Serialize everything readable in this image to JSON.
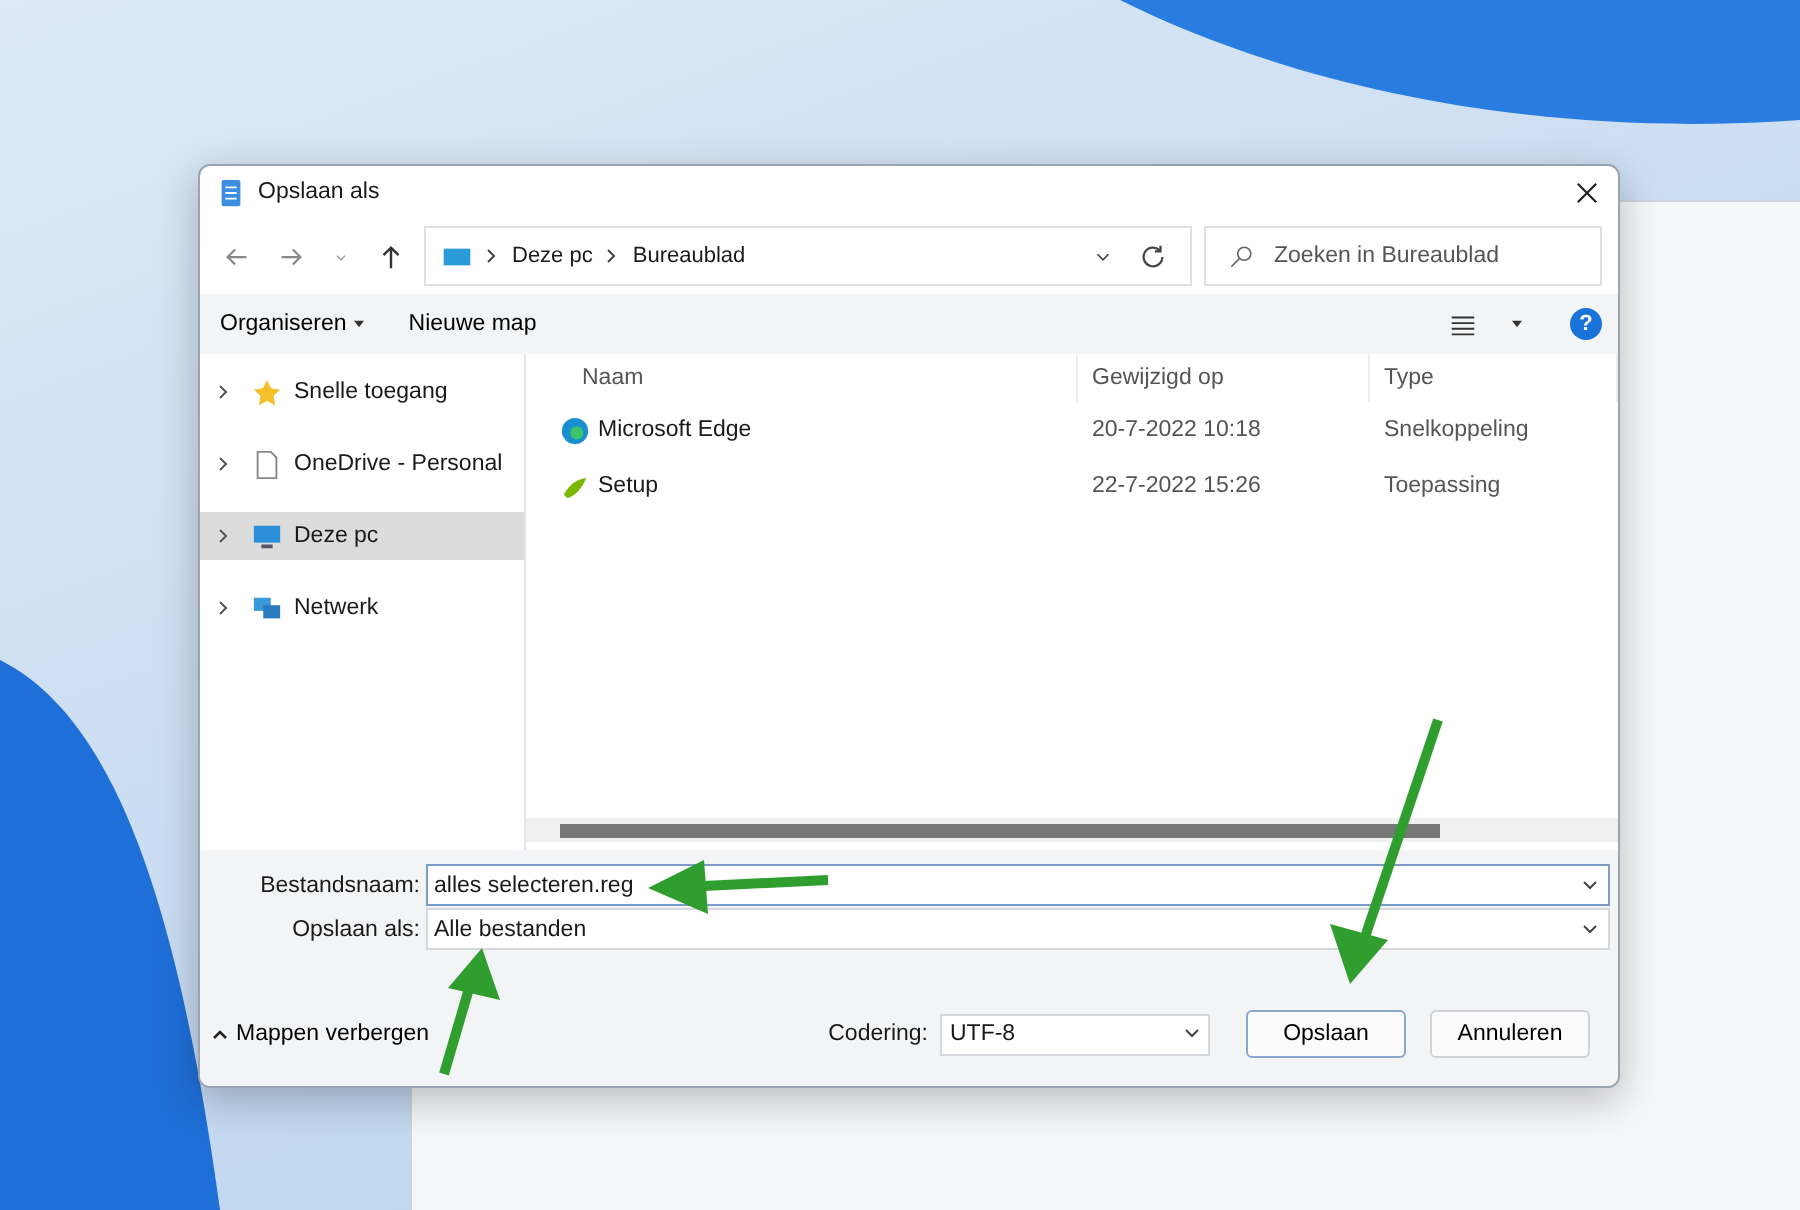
{
  "window": {
    "title": "Opslaan als"
  },
  "address": {
    "crumbs": [
      "Deze pc",
      "Bureaublad"
    ]
  },
  "search": {
    "placeholder": "Zoeken in Bureaublad"
  },
  "toolbar": {
    "organize": "Organiseren",
    "new_folder": "Nieuwe map",
    "help": "?"
  },
  "sidebar": {
    "items": [
      {
        "label": "Snelle toegang",
        "kind": "star",
        "selected": false
      },
      {
        "label": "OneDrive - Personal",
        "kind": "document",
        "selected": false
      },
      {
        "label": "Deze pc",
        "kind": "computer",
        "selected": true
      },
      {
        "label": "Netwerk",
        "kind": "network",
        "selected": false
      }
    ]
  },
  "table": {
    "columns": [
      "Naam",
      "Gewijzigd op",
      "Type"
    ],
    "rows": [
      {
        "name": "Microsoft Edge",
        "kind": "edge",
        "modified": "20-7-2022 10:18",
        "type": "Snelkoppeling"
      },
      {
        "name": "Setup",
        "kind": "setup",
        "modified": "22-7-2022 15:26",
        "type": "Toepassing"
      }
    ]
  },
  "fields": {
    "filename_label": "Bestandsnaam:",
    "filename": "alles selecteren.reg",
    "type_label": "Opslaan als:",
    "type": "Alle bestanden"
  },
  "footer": {
    "hide_folders": "Mappen verbergen",
    "encoding_label": "Codering:",
    "encoding": "UTF-8",
    "save": "Opslaan",
    "cancel": "Annuleren"
  }
}
